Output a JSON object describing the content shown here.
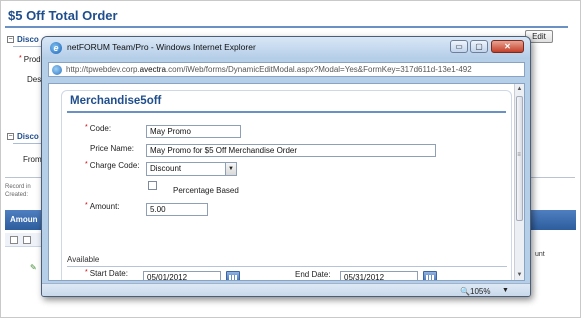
{
  "background": {
    "page_title": "$5 Off Total Order",
    "section_discount": "Disco",
    "label_prod": "Prod",
    "label_des": "Des",
    "section_discount2": "Disco",
    "label_from": "From",
    "edit_button": "Edit",
    "record_line1": "Record in",
    "record_line2": "Created:",
    "amount_tab": "Amoun",
    "grid_col_unt": "unt"
  },
  "window": {
    "title": "netFORUM Team/Pro - Windows Internet Explorer",
    "address_prefix": "http://tpwebdev.corp.",
    "address_host": "avectra",
    "address_suffix": ".com/iWeb/forms/DynamicEditModal.aspx?Modal=Yes&FormKey=317d611d-13e1-492",
    "minimize_glyph": "▭",
    "maximize_glyph": "▢",
    "close_glyph": "✕",
    "zoom": "105%",
    "zoom_dropdown_glyph": "▼"
  },
  "form": {
    "title": "Merchandise5off",
    "code_label": "Code:",
    "code_value": "May Promo",
    "price_name_label": "Price Name:",
    "price_name_value": "May Promo for $5 Off Merchandise Order",
    "charge_code_label": "Charge Code:",
    "charge_code_value": "Discount",
    "percentage_label": "Percentage Based",
    "amount_label": "Amount:",
    "amount_value": "5.00",
    "available_label": "Available",
    "start_date_label": "Start Date:",
    "start_date_value": "05/01/2012",
    "end_date_label": "End Date:",
    "end_date_value": "05/31/2012",
    "required_marker": "*"
  }
}
